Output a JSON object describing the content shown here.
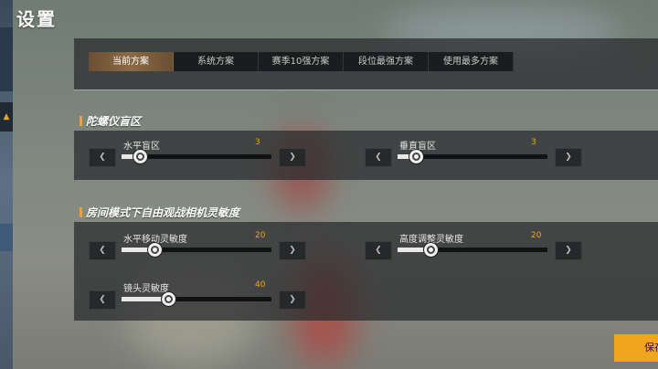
{
  "title": "设置",
  "tabs": [
    "当前方案",
    "系统方案",
    "赛季10强方案",
    "段位最强方案",
    "使用最多方案"
  ],
  "sections": [
    {
      "title": "陀螺仪盲区",
      "controls": [
        {
          "label": "水平盲区",
          "value": "3",
          "level": 0.12
        },
        {
          "label": "垂直盲区",
          "value": "3",
          "level": 0.12
        }
      ]
    },
    {
      "title": "房间模式下自由观战相机灵敏度",
      "controls": [
        {
          "label": "水平移动灵敏度",
          "value": "20",
          "level": 0.22
        },
        {
          "label": "高度调整灵敏度",
          "value": "20",
          "level": 0.22
        },
        {
          "label": "镜头灵敏度",
          "value": "40",
          "level": 0.31
        }
      ]
    }
  ],
  "buttons": {
    "minus": "❮",
    "plus": "❯",
    "save": "保存"
  },
  "accent_color": "#f1a51c",
  "left_rail_icon": "left-arrow-icon"
}
